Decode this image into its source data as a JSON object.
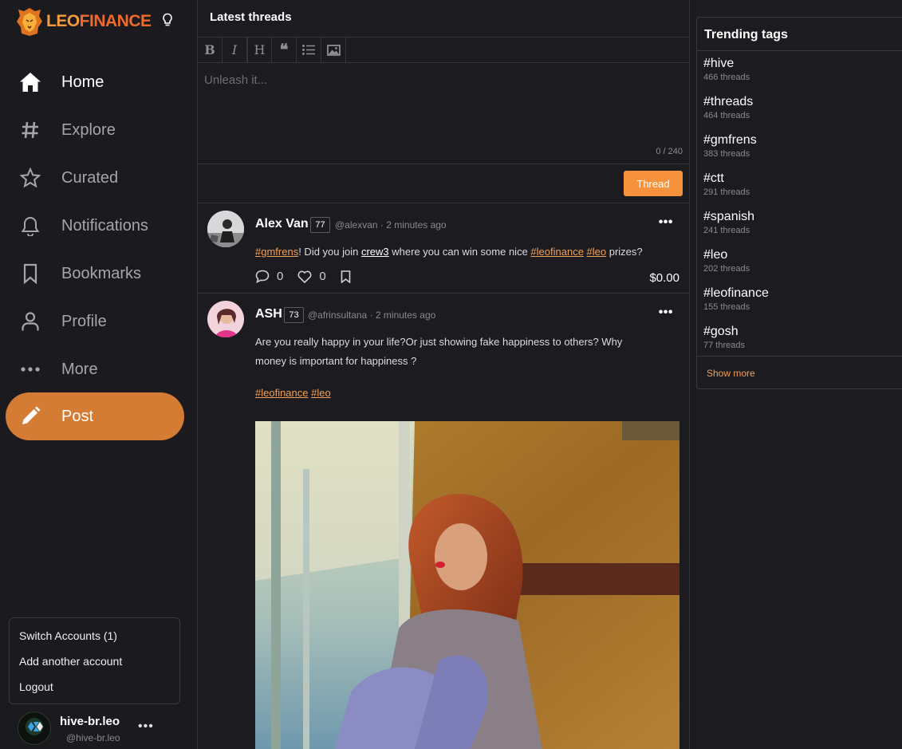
{
  "brand": {
    "logo_part1": "LEO",
    "logo_part2": "FINANCE"
  },
  "nav": [
    {
      "label": "Home",
      "icon": "home-icon"
    },
    {
      "label": "Explore",
      "icon": "hash-icon"
    },
    {
      "label": "Curated",
      "icon": "star-icon"
    },
    {
      "label": "Notifications",
      "icon": "bell-icon"
    },
    {
      "label": "Bookmarks",
      "icon": "bookmark-icon"
    },
    {
      "label": "Profile",
      "icon": "user-icon"
    },
    {
      "label": "More",
      "icon": "more-icon"
    }
  ],
  "post_button": "Post",
  "account_menu": {
    "switch": "Switch Accounts (1)",
    "add": "Add another account",
    "logout": "Logout"
  },
  "user": {
    "name": "hive-br.leo",
    "handle": "@hive-br.leo"
  },
  "main": {
    "title": "Latest threads",
    "editor": {
      "placeholder": "Unleash it...",
      "counter": "0 / 240",
      "submit": "Thread"
    }
  },
  "posts": [
    {
      "author": "Alex Van",
      "rep": "77",
      "handle": "@alexvan",
      "time": "2 minutes ago",
      "text": {
        "tag1": "#gmfrens",
        "t1": "! Did you join ",
        "link": "crew3",
        "t2": " where you can win some nice ",
        "tag2": "#leofinance",
        "tag3": "#leo",
        "t3": " prizes?"
      },
      "comments": "0",
      "likes": "0",
      "payout": "$0.00"
    },
    {
      "author": "ASH",
      "rep": "73",
      "handle": "@afrinsultana",
      "time": "2 minutes ago",
      "text": {
        "line1": "Are you really happy in your life?Or just showing fake happiness to others? Why",
        "line2": "money is important for happiness ?",
        "tag1": "#leofinance",
        "tag2": "#leo"
      }
    }
  ],
  "trending": {
    "title": "Trending tags",
    "tags": [
      {
        "name": "#hive",
        "count": "466 threads"
      },
      {
        "name": "#threads",
        "count": "464 threads"
      },
      {
        "name": "#gmfrens",
        "count": "383 threads"
      },
      {
        "name": "#ctt",
        "count": "291 threads"
      },
      {
        "name": "#spanish",
        "count": "241 threads"
      },
      {
        "name": "#leo",
        "count": "202 threads"
      },
      {
        "name": "#leofinance",
        "count": "155 threads"
      },
      {
        "name": "#gosh",
        "count": "77 threads"
      }
    ],
    "show_more": "Show more"
  },
  "colors": {
    "accent": "#f5923b",
    "post_button": "#d47b34",
    "background": "#1c1b1f",
    "tag": "#f2a05a"
  }
}
